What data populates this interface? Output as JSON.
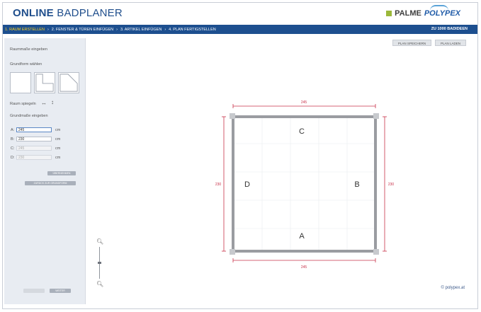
{
  "header": {
    "title_main": "ONLINE",
    "title_sub": "BADPLANER",
    "logo_palme": "PALME",
    "logo_polypex": "POLYPEX"
  },
  "nav": {
    "steps": [
      "1. RAUM ERSTELLEN",
      "2. FENSTER & TÜREN EINFÜGEN",
      "3. ARTIKEL EINFÜGEN",
      "4. PLAN FERTIGSTELLEN"
    ],
    "separator": "›",
    "right_link": "ZU 1000 BADIDEEN"
  },
  "toolbar": {
    "save_label": "PLAN SPEICHERN",
    "load_label": "PLAN LADEN"
  },
  "sidebar": {
    "heading_dims": "Raummaße eingeben",
    "heading_shape": "Grundform wählen",
    "mirror_label": "Raum spiegeln",
    "heading_base": "Grundmaße eingeben",
    "fields": [
      {
        "label": "A:",
        "value": "245",
        "unit": "cm"
      },
      {
        "label": "B:",
        "value": "230",
        "unit": "cm"
      },
      {
        "label": "C:",
        "value": "245",
        "unit": "cm"
      },
      {
        "label": "D:",
        "value": "230",
        "unit": "cm"
      }
    ],
    "apply_label": "ÜBERNEHMEN",
    "back_label": "ZURÜCK ZUR GRUNDFORM",
    "prev_label": "",
    "next_label": "WEITER"
  },
  "plan": {
    "dim_top": "245",
    "dim_bottom": "245",
    "dim_left": "230",
    "dim_right": "230",
    "wall_a": "A",
    "wall_b": "B",
    "wall_c": "C",
    "wall_d": "D"
  },
  "footer": {
    "copyright": "© polypex.at"
  },
  "colors": {
    "nav_bg": "#1d4f8f",
    "nav_active": "#ffd21f",
    "title": "#1f4e8c",
    "dimension": "#c8324a",
    "wall": "#9a9ca1"
  }
}
